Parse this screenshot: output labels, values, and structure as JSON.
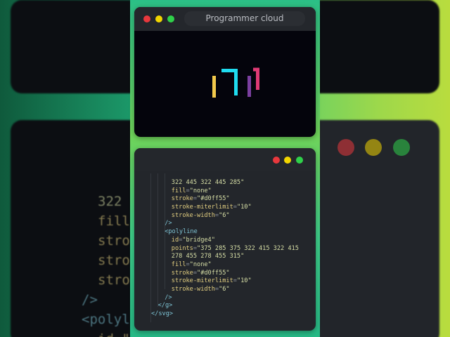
{
  "window_title": "Programmer cloud",
  "colors": {
    "red": "#e8383d",
    "yellow": "#f2d600",
    "green": "#2fd14a",
    "logo_yellow": "#f2c94c",
    "logo_cyan": "#1fdcf0",
    "logo_purple": "#7b3fa0",
    "logo_pink": "#e03a75"
  },
  "code_lines": [
    {
      "indent": 3,
      "parts": [
        {
          "c": "s",
          "t": "322 445 322 445 285\""
        }
      ]
    },
    {
      "indent": 3,
      "parts": [
        {
          "c": "a",
          "t": "fill"
        },
        {
          "c": "e",
          "t": "="
        },
        {
          "c": "s",
          "t": "\"none\""
        }
      ]
    },
    {
      "indent": 3,
      "parts": [
        {
          "c": "a",
          "t": "stroke"
        },
        {
          "c": "e",
          "t": "="
        },
        {
          "c": "s",
          "t": "\"#d0ff55\""
        }
      ]
    },
    {
      "indent": 3,
      "parts": [
        {
          "c": "a",
          "t": "stroke-miterlimit"
        },
        {
          "c": "e",
          "t": "="
        },
        {
          "c": "s",
          "t": "\"10\""
        }
      ]
    },
    {
      "indent": 3,
      "parts": [
        {
          "c": "a",
          "t": "stroke-width"
        },
        {
          "c": "e",
          "t": "="
        },
        {
          "c": "s",
          "t": "\"6\""
        }
      ]
    },
    {
      "indent": 2,
      "parts": [
        {
          "c": "t",
          "t": "/>"
        }
      ]
    },
    {
      "indent": 2,
      "parts": [
        {
          "c": "t",
          "t": "<polyline"
        }
      ]
    },
    {
      "indent": 3,
      "parts": [
        {
          "c": "a",
          "t": "id"
        },
        {
          "c": "e",
          "t": "="
        },
        {
          "c": "s",
          "t": "\"bridge4\""
        }
      ]
    },
    {
      "indent": 3,
      "parts": [
        {
          "c": "a",
          "t": "points"
        },
        {
          "c": "e",
          "t": "="
        },
        {
          "c": "s",
          "t": "\"375 285 375 322 415 322 415"
        }
      ]
    },
    {
      "indent": 3,
      "parts": [
        {
          "c": "s",
          "t": "278 455 278 455 315\""
        }
      ]
    },
    {
      "indent": 3,
      "parts": [
        {
          "c": "a",
          "t": "fill"
        },
        {
          "c": "e",
          "t": "="
        },
        {
          "c": "s",
          "t": "\"none\""
        }
      ]
    },
    {
      "indent": 3,
      "parts": [
        {
          "c": "a",
          "t": "stroke"
        },
        {
          "c": "e",
          "t": "="
        },
        {
          "c": "s",
          "t": "\"#d0ff55\""
        }
      ]
    },
    {
      "indent": 3,
      "parts": [
        {
          "c": "a",
          "t": "stroke-miterlimit"
        },
        {
          "c": "e",
          "t": "="
        },
        {
          "c": "s",
          "t": "\"10\""
        }
      ]
    },
    {
      "indent": 3,
      "parts": [
        {
          "c": "a",
          "t": "stroke-width"
        },
        {
          "c": "e",
          "t": "="
        },
        {
          "c": "s",
          "t": "\"6\""
        }
      ]
    },
    {
      "indent": 2,
      "parts": [
        {
          "c": "t",
          "t": "/>"
        }
      ]
    },
    {
      "indent": 1,
      "parts": [
        {
          "c": "t",
          "t": "</g>"
        }
      ]
    },
    {
      "indent": 0,
      "parts": [
        {
          "c": "t",
          "t": "</svg>"
        }
      ]
    }
  ],
  "background_code": [
    "322",
    "fill",
    "stro",
    "stro",
    "stro",
    "/>",
    "<polyl",
    "id=\""
  ]
}
